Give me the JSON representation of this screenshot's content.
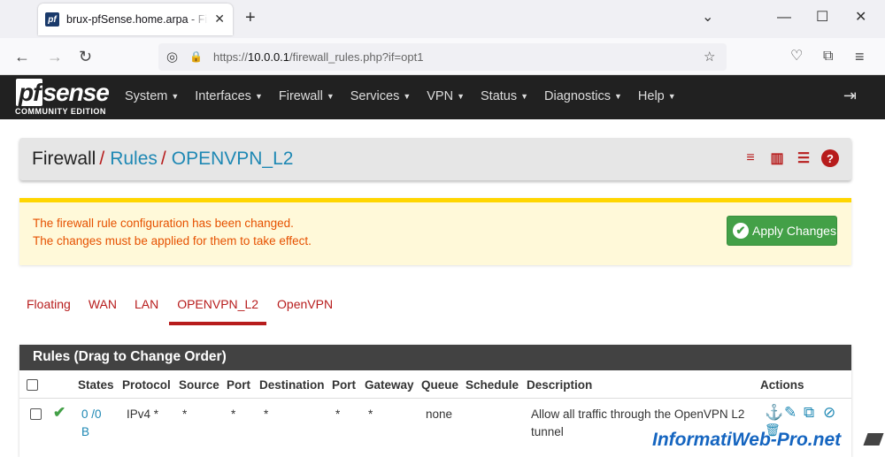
{
  "browser": {
    "tab_title": "brux-pfSense.home.arpa - Firewall: Rules",
    "tab_favicon": "pf",
    "tab_close_icon": "✕",
    "new_tab_icon": "+",
    "url_prefix": "https://",
    "url_host": "10.0.0.1",
    "url_path": "/firewall_rules.php?if=opt1",
    "buttons": {
      "back": "←",
      "forward": "→",
      "reload": "↻",
      "bookmark": "☆",
      "pocket": "♡",
      "extensions": "⧉",
      "menu": "≡",
      "tracking": "◎",
      "lock": "🔒",
      "list_tabs": "⌄",
      "minimize": "—",
      "maximize": "☐",
      "close": "✕"
    }
  },
  "header": {
    "logo_pf": "pf",
    "logo_sense": "sense",
    "logo_sub": "COMMUNITY EDITION",
    "menu": [
      "System",
      "Interfaces",
      "Firewall",
      "Services",
      "VPN",
      "Status",
      "Diagnostics",
      "Help"
    ],
    "caret": "▼",
    "logout_icon": "⇥"
  },
  "breadcrumb": {
    "root": "Firewall",
    "sep": "/",
    "rules": "Rules",
    "iface": "OPENVPN_L2",
    "icons": {
      "filter": "≡",
      "chart": "▥",
      "log": "☰",
      "help": "?"
    }
  },
  "alert": {
    "line1": "The firewall rule configuration has been changed.",
    "line2": "The changes must be applied for them to take effect.",
    "apply_label": "Apply Changes",
    "check": "✔"
  },
  "tabs": [
    "Floating",
    "WAN",
    "LAN",
    "OPENVPN_L2",
    "OpenVPN"
  ],
  "rules": {
    "heading": "Rules (Drag to Change Order)",
    "columns": [
      "States",
      "Protocol",
      "Source",
      "Port",
      "Destination",
      "Port",
      "Gateway",
      "Queue",
      "Schedule",
      "Description",
      "Actions"
    ],
    "row": {
      "status_icon": "✔",
      "states_1": "0 /0",
      "states_2": "B",
      "protocol": "IPv4 *",
      "source": "*",
      "sport": "*",
      "destination": "*",
      "dport": "*",
      "gateway": "*",
      "queue": "none",
      "schedule": "",
      "description_1": "Allow all traffic through the OpenVPN L2",
      "description_2": "tunnel",
      "actions": {
        "anchor": "⚓",
        "edit": "✎",
        "copy": "⧉",
        "disable": "⊘",
        "delete": "🗑"
      }
    }
  },
  "watermark": "InformatiWeb-Pro.net"
}
